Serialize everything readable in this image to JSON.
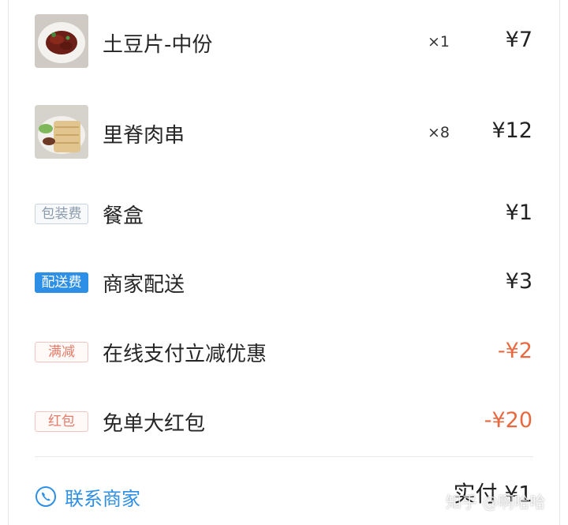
{
  "items": [
    {
      "name": "土豆片-中份",
      "qty": "×1",
      "price": "¥7",
      "thumb_icon": "potato-slice-dish-photo"
    },
    {
      "name": "里脊肉串",
      "qty": "×8",
      "price": "¥12",
      "thumb_icon": "pork-skewer-dish-photo"
    }
  ],
  "fees": [
    {
      "tag": "包装费",
      "name": "餐盒",
      "price": "¥1"
    },
    {
      "tag": "配送费",
      "name": "商家配送",
      "price": "¥3"
    }
  ],
  "discounts": [
    {
      "tag": "满减",
      "name": "在线支付立减优惠",
      "price": "-¥2"
    },
    {
      "tag": "红包",
      "name": "免单大红包",
      "price": "-¥20"
    }
  ],
  "footer": {
    "contact_label": "联系商家",
    "paid_text": "实付 ¥1",
    "watermark": "知乎 @啊哈哈"
  },
  "colors": {
    "accent_blue": "#2d8fe6",
    "discount_red": "#e8693f"
  }
}
